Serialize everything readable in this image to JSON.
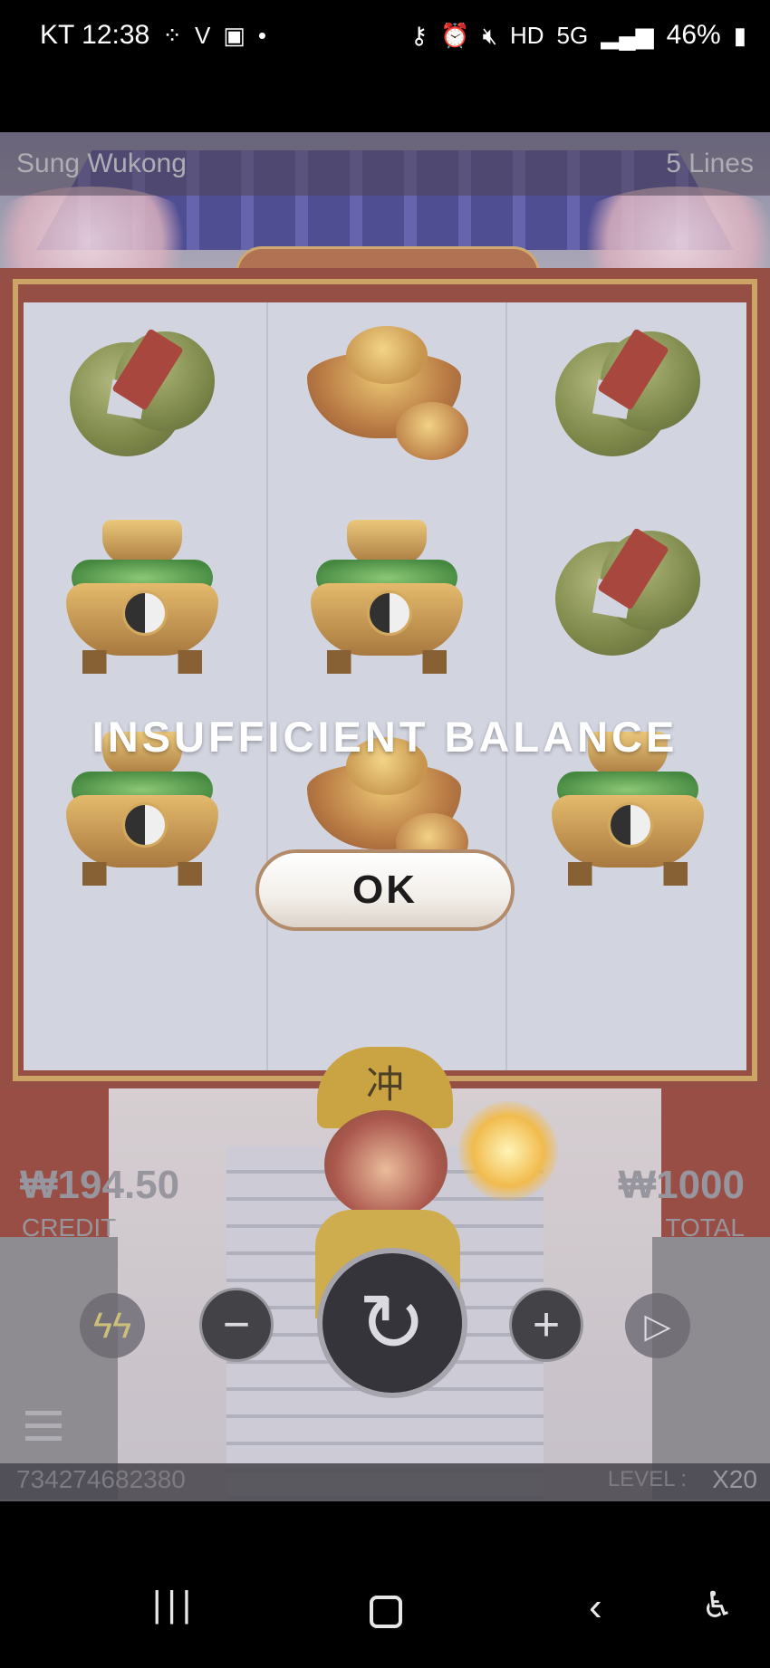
{
  "status_bar": {
    "carrier_time": "KT 12:38",
    "battery": "46%"
  },
  "game": {
    "title": "Sung Wukong",
    "lines": "5 Lines",
    "reels": [
      [
        "coin",
        "pot",
        "pot"
      ],
      [
        "ingot",
        "pot",
        "ingot"
      ],
      [
        "coin",
        "coin",
        "pot"
      ]
    ],
    "credit": {
      "value": "₩194.50",
      "label": "CREDIT"
    },
    "total": {
      "value": "₩1000",
      "label": "TOTAL"
    },
    "round_id": "734274682380",
    "level_label": "LEVEL :",
    "level_value": "X20",
    "hat_glyph": "冲"
  },
  "dialog": {
    "message": "INSUFFICIENT BALANCE",
    "ok_label": "OK"
  },
  "icons": {
    "turbo": "turbo-icon",
    "minus": "minus-icon",
    "spin": "spin-icon",
    "plus": "plus-icon",
    "autoplay": "autoplay-icon",
    "menu": "menu-icon"
  }
}
